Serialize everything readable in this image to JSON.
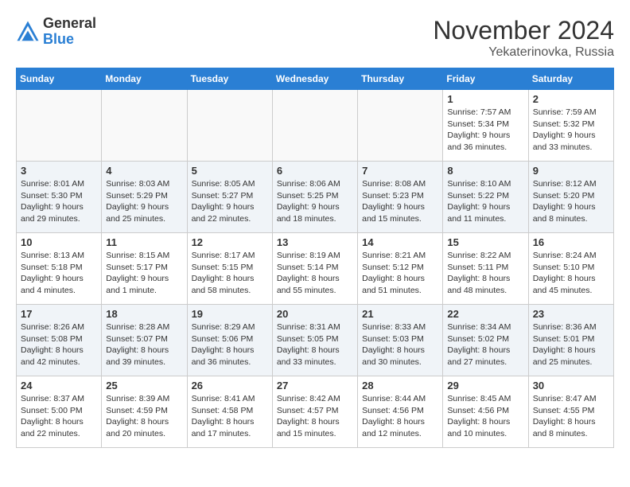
{
  "header": {
    "logo_general": "General",
    "logo_blue": "Blue",
    "month_title": "November 2024",
    "location": "Yekaterinovka, Russia"
  },
  "days_of_week": [
    "Sunday",
    "Monday",
    "Tuesday",
    "Wednesday",
    "Thursday",
    "Friday",
    "Saturday"
  ],
  "weeks": [
    [
      {
        "day": "",
        "info": ""
      },
      {
        "day": "",
        "info": ""
      },
      {
        "day": "",
        "info": ""
      },
      {
        "day": "",
        "info": ""
      },
      {
        "day": "",
        "info": ""
      },
      {
        "day": "1",
        "info": "Sunrise: 7:57 AM\nSunset: 5:34 PM\nDaylight: 9 hours and 36 minutes."
      },
      {
        "day": "2",
        "info": "Sunrise: 7:59 AM\nSunset: 5:32 PM\nDaylight: 9 hours and 33 minutes."
      }
    ],
    [
      {
        "day": "3",
        "info": "Sunrise: 8:01 AM\nSunset: 5:30 PM\nDaylight: 9 hours and 29 minutes."
      },
      {
        "day": "4",
        "info": "Sunrise: 8:03 AM\nSunset: 5:29 PM\nDaylight: 9 hours and 25 minutes."
      },
      {
        "day": "5",
        "info": "Sunrise: 8:05 AM\nSunset: 5:27 PM\nDaylight: 9 hours and 22 minutes."
      },
      {
        "day": "6",
        "info": "Sunrise: 8:06 AM\nSunset: 5:25 PM\nDaylight: 9 hours and 18 minutes."
      },
      {
        "day": "7",
        "info": "Sunrise: 8:08 AM\nSunset: 5:23 PM\nDaylight: 9 hours and 15 minutes."
      },
      {
        "day": "8",
        "info": "Sunrise: 8:10 AM\nSunset: 5:22 PM\nDaylight: 9 hours and 11 minutes."
      },
      {
        "day": "9",
        "info": "Sunrise: 8:12 AM\nSunset: 5:20 PM\nDaylight: 9 hours and 8 minutes."
      }
    ],
    [
      {
        "day": "10",
        "info": "Sunrise: 8:13 AM\nSunset: 5:18 PM\nDaylight: 9 hours and 4 minutes."
      },
      {
        "day": "11",
        "info": "Sunrise: 8:15 AM\nSunset: 5:17 PM\nDaylight: 9 hours and 1 minute."
      },
      {
        "day": "12",
        "info": "Sunrise: 8:17 AM\nSunset: 5:15 PM\nDaylight: 8 hours and 58 minutes."
      },
      {
        "day": "13",
        "info": "Sunrise: 8:19 AM\nSunset: 5:14 PM\nDaylight: 8 hours and 55 minutes."
      },
      {
        "day": "14",
        "info": "Sunrise: 8:21 AM\nSunset: 5:12 PM\nDaylight: 8 hours and 51 minutes."
      },
      {
        "day": "15",
        "info": "Sunrise: 8:22 AM\nSunset: 5:11 PM\nDaylight: 8 hours and 48 minutes."
      },
      {
        "day": "16",
        "info": "Sunrise: 8:24 AM\nSunset: 5:10 PM\nDaylight: 8 hours and 45 minutes."
      }
    ],
    [
      {
        "day": "17",
        "info": "Sunrise: 8:26 AM\nSunset: 5:08 PM\nDaylight: 8 hours and 42 minutes."
      },
      {
        "day": "18",
        "info": "Sunrise: 8:28 AM\nSunset: 5:07 PM\nDaylight: 8 hours and 39 minutes."
      },
      {
        "day": "19",
        "info": "Sunrise: 8:29 AM\nSunset: 5:06 PM\nDaylight: 8 hours and 36 minutes."
      },
      {
        "day": "20",
        "info": "Sunrise: 8:31 AM\nSunset: 5:05 PM\nDaylight: 8 hours and 33 minutes."
      },
      {
        "day": "21",
        "info": "Sunrise: 8:33 AM\nSunset: 5:03 PM\nDaylight: 8 hours and 30 minutes."
      },
      {
        "day": "22",
        "info": "Sunrise: 8:34 AM\nSunset: 5:02 PM\nDaylight: 8 hours and 27 minutes."
      },
      {
        "day": "23",
        "info": "Sunrise: 8:36 AM\nSunset: 5:01 PM\nDaylight: 8 hours and 25 minutes."
      }
    ],
    [
      {
        "day": "24",
        "info": "Sunrise: 8:37 AM\nSunset: 5:00 PM\nDaylight: 8 hours and 22 minutes."
      },
      {
        "day": "25",
        "info": "Sunrise: 8:39 AM\nSunset: 4:59 PM\nDaylight: 8 hours and 20 minutes."
      },
      {
        "day": "26",
        "info": "Sunrise: 8:41 AM\nSunset: 4:58 PM\nDaylight: 8 hours and 17 minutes."
      },
      {
        "day": "27",
        "info": "Sunrise: 8:42 AM\nSunset: 4:57 PM\nDaylight: 8 hours and 15 minutes."
      },
      {
        "day": "28",
        "info": "Sunrise: 8:44 AM\nSunset: 4:56 PM\nDaylight: 8 hours and 12 minutes."
      },
      {
        "day": "29",
        "info": "Sunrise: 8:45 AM\nSunset: 4:56 PM\nDaylight: 8 hours and 10 minutes."
      },
      {
        "day": "30",
        "info": "Sunrise: 8:47 AM\nSunset: 4:55 PM\nDaylight: 8 hours and 8 minutes."
      }
    ]
  ]
}
